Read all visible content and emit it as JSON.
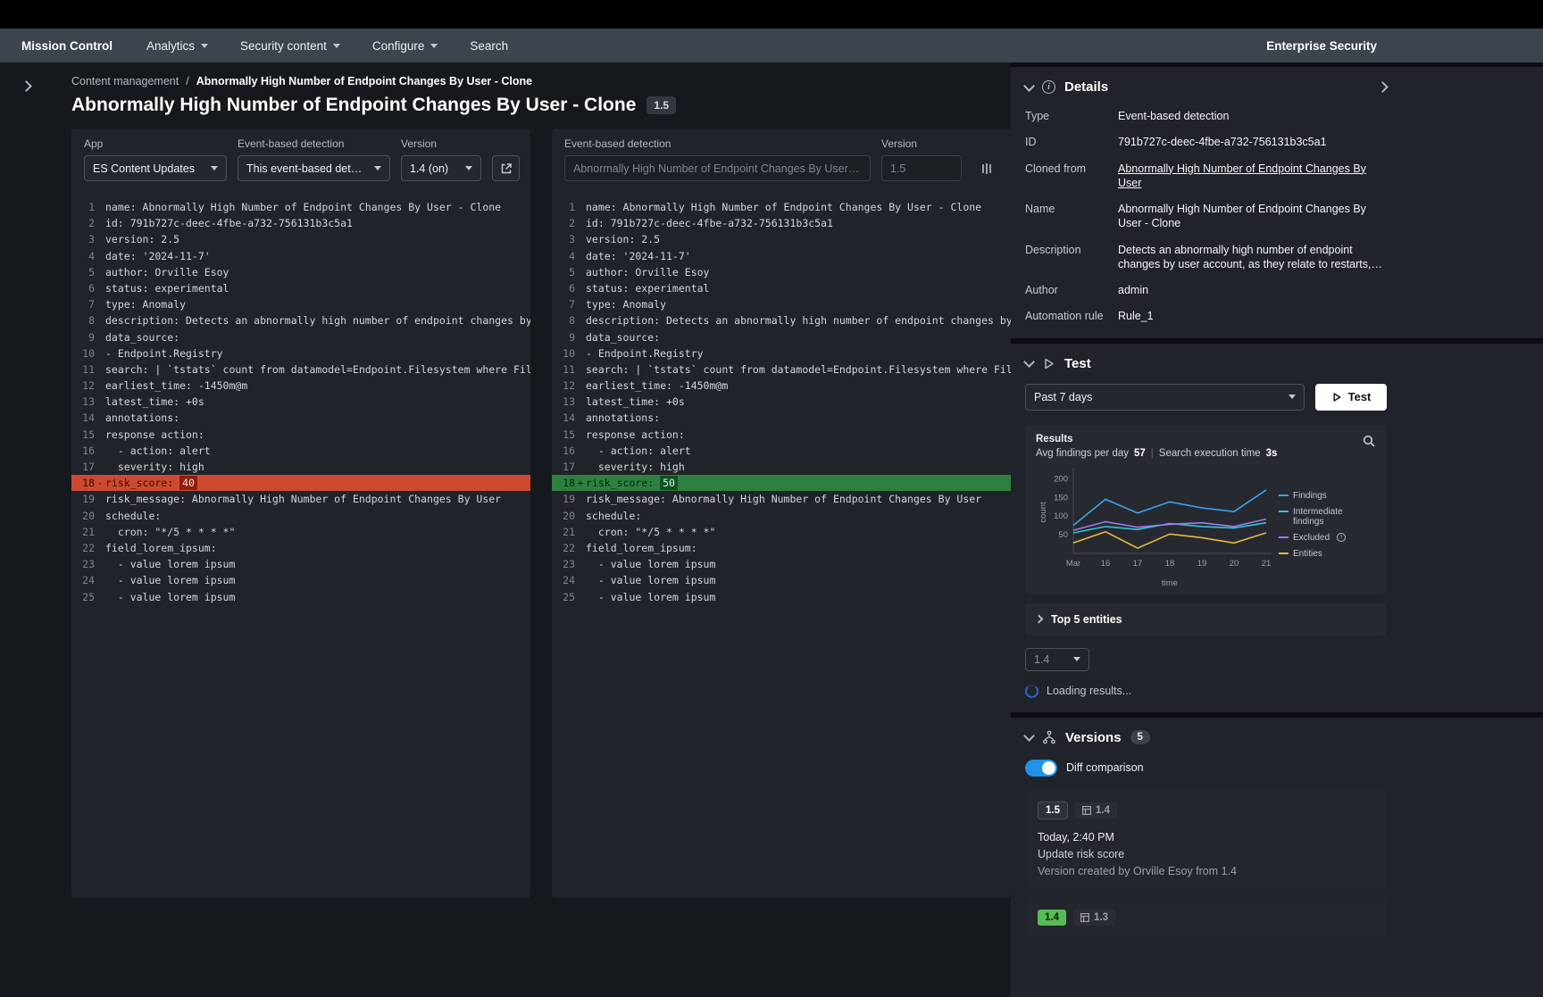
{
  "topnav": {
    "brand": "Mission Control",
    "items": [
      {
        "label": "Analytics",
        "caret": true
      },
      {
        "label": "Security content",
        "caret": true
      },
      {
        "label": "Configure",
        "caret": true
      },
      {
        "label": "Search",
        "caret": false
      }
    ],
    "right_label": "Enterprise Security"
  },
  "breadcrumb": {
    "parent": "Content management",
    "separator": "/",
    "current": "Abnormally High Number of Endpoint Changes By User - Clone"
  },
  "page": {
    "title": "Abnormally High Number of Endpoint Changes By User - Clone",
    "version_badge": "1.5"
  },
  "editor": {
    "left": {
      "app_label": "App",
      "app_value": "ES Content Updates",
      "type_label": "Event-based detection",
      "type_value": "This event-based detection",
      "version_label": "Version",
      "version_value": "1.4 (on)"
    },
    "right": {
      "type_label": "Event-based detection",
      "name_value": "Abnormally High Number of Endpoint Changes By User - Clo...",
      "version_label": "Version",
      "version_value": "1.5"
    },
    "code_lines": [
      "name: Abnormally High Number of Endpoint Changes By User - Clone",
      "id: 791b727c-deec-4fbe-a732-756131b3c5a1",
      "version: 2.5",
      "date: '2024-11-7'",
      "author: Orville Esoy",
      "status: experimental",
      "type: Anomaly",
      "description: Detects an abnormally high number of endpoint changes by user account, as they relate to restarts,",
      "data_source:",
      "- Endpoint.Registry",
      "search: | `tstats` count from datamodel=Endpoint.Filesystem where Filesystem",
      "earliest_time: -1450m@m",
      "latest_time: +0s",
      "annotations:",
      "response action:",
      "  - action: alert",
      "  severity: high",
      null,
      "risk_message: Abnormally High Number of Endpoint Changes By User",
      "schedule:",
      "  cron: \"*/5 * * * *\"",
      "field_lorem_ipsum:",
      "  - value lorem ipsum",
      "  - value lorem ipsum",
      "  - value lorem ipsum"
    ],
    "diff": {
      "line_number": 18,
      "prefix": "risk_score: ",
      "removed_value": "40",
      "added_value": "50",
      "removed_color": "#cd4a31",
      "added_color": "#2e8040"
    }
  },
  "details": {
    "title": "Details",
    "fields": [
      {
        "label": "Type",
        "value": "Event-based detection",
        "link": false
      },
      {
        "label": "ID",
        "value": "791b727c-deec-4fbe-a732-756131b3c5a1",
        "link": false
      },
      {
        "label": "Cloned from",
        "value": "Abnormally High Number of Endpoint Changes By User",
        "link": true
      },
      {
        "label": "Name",
        "value": "Abnormally High Number of Endpoint Changes By User - Clone",
        "link": false
      },
      {
        "label": "Description",
        "value": "Detects an abnormally high number of endpoint changes by user account, as they relate to restarts,…",
        "link": false
      },
      {
        "label": "Author",
        "value": "admin",
        "link": false
      },
      {
        "label": "Automation rule",
        "value": "Rule_1",
        "link": false
      }
    ]
  },
  "test": {
    "title": "Test",
    "range_value": "Past 7 days",
    "button_label": "Test",
    "results_title": "Results",
    "avg_label": "Avg findings per day",
    "avg_value": "57",
    "stat_separator": "|",
    "exec_label": "Search execution time",
    "exec_value": "3s",
    "top_entities_label": "Top 5 entities",
    "version_select_value": "1.4",
    "loading_label": "Loading results..."
  },
  "chart_data": {
    "type": "line",
    "x": [
      "Mar",
      "16",
      "17",
      "18",
      "19",
      "20",
      "21"
    ],
    "series": [
      {
        "name": "Findings",
        "color": "#3fa2ec",
        "values": [
          75,
          145,
          108,
          138,
          122,
          112,
          170
        ],
        "info": false
      },
      {
        "name": "Intermediate findings",
        "color": "#2fc6d8",
        "values": [
          55,
          72,
          64,
          80,
          72,
          68,
          82
        ],
        "info": false
      },
      {
        "name": "Excluded",
        "color": "#9d7bf0",
        "values": [
          62,
          85,
          70,
          78,
          82,
          72,
          92
        ],
        "info": true
      },
      {
        "name": "Entities",
        "color": "#e8b93c",
        "values": [
          28,
          58,
          14,
          52,
          42,
          28,
          55
        ],
        "info": false
      }
    ],
    "ylabel": "count",
    "xlabel": "time",
    "yticks": [
      50,
      100,
      150,
      200
    ],
    "ylim": [
      0,
      220
    ],
    "legend_position": "right",
    "grid": false
  },
  "versions": {
    "title": "Versions",
    "count": "5",
    "toggle_label": "Diff comparison",
    "toggle_on_color": "#1e93eb",
    "items": [
      {
        "badge": "1.5",
        "badge_style": "dark",
        "compare": "1.4",
        "time": "Today, 2:40 PM",
        "note": "Update risk score",
        "created": "Version created by Orville Esoy from 1.4"
      },
      {
        "badge": "1.4",
        "badge_style": "green",
        "compare": "1.3",
        "time": "",
        "note": "",
        "created": ""
      }
    ]
  }
}
